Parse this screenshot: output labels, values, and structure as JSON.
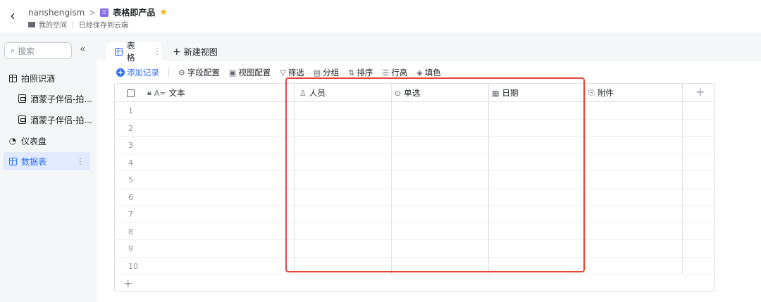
{
  "topbar": {
    "back_icon": "chevron-left-icon",
    "breadcrumb_parent": "nanshengism",
    "doc_title": "表格即产品",
    "location": "我的空间",
    "save_status": "已经保存到云端",
    "star_color": "#f5b301",
    "doc_icon_color": "#8a6cf0"
  },
  "sidebar": {
    "search_placeholder": "搜索",
    "collapse_icon": "double-chevron-left-icon",
    "items": [
      {
        "label": "拍照识酒",
        "icon": "table-icon"
      },
      {
        "label": "酒蒙子伴侣-拍...",
        "icon": "form-icon"
      },
      {
        "label": "酒蒙子伴侣-拍...",
        "icon": "form-icon"
      },
      {
        "label": "仪表盘",
        "icon": "dashboard-icon"
      },
      {
        "label": "数据表",
        "icon": "table-icon",
        "active": true
      }
    ]
  },
  "tabs": {
    "active_tab": "表格",
    "new_view": "新建视图"
  },
  "toolbar": {
    "add_record": "添加记录",
    "field_config": "字段配置",
    "view_config": "视图配置",
    "filter": "筛选",
    "group": "分组",
    "sort": "排序",
    "row_height": "行高",
    "fill_color": "填色"
  },
  "table": {
    "columns": [
      {
        "label": "文本",
        "icon": "text-field-icon",
        "prefix": "A="
      },
      {
        "label": "人员",
        "icon": "person-icon"
      },
      {
        "label": "单选",
        "icon": "single-select-icon"
      },
      {
        "label": "日期",
        "icon": "calendar-icon"
      },
      {
        "label": "附件",
        "icon": "paperclip-icon"
      }
    ],
    "rows": [
      "1",
      "2",
      "3",
      "4",
      "5",
      "6",
      "7",
      "8",
      "9",
      "10"
    ]
  },
  "colors": {
    "accent": "#3370ff",
    "highlight": "#e8453c"
  }
}
